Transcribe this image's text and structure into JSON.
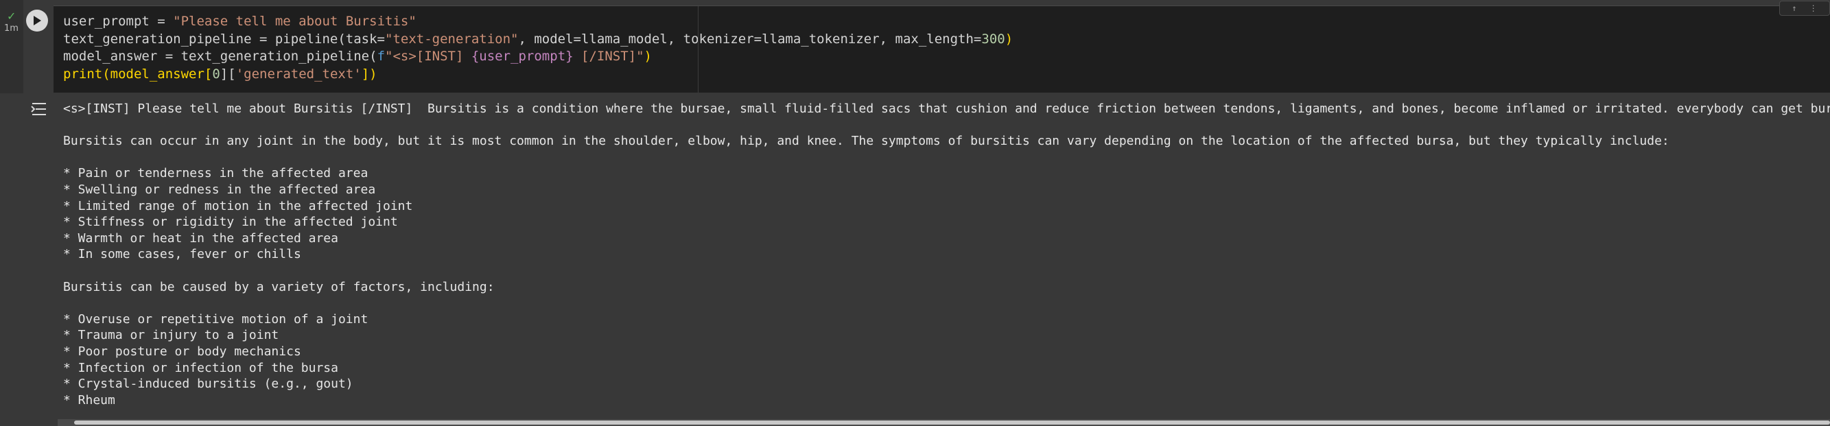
{
  "cell": {
    "status_icon": "check-icon",
    "exec_time": "1m",
    "code_lines": {
      "line1": {
        "a": "user_prompt = ",
        "b": "\"Please tell me about Bursitis\""
      },
      "line2": {
        "a": "text_generation_pipeline = pipeline(task=",
        "b": "\"text-generation\"",
        "c": ", model=llama_model, tokenizer=llama_tokenizer, max_length=",
        "d": "300",
        "e": ")"
      },
      "line3": {
        "a": "model_answer = text_generation_pipeline(",
        "f": "f",
        "b": "\"<s>[INST] ",
        "c": "{user_prompt}",
        "d": " [/INST]\"",
        "e": ")"
      },
      "line4": {
        "a": "print(model_answer[",
        "b": "0",
        "c": "][",
        "d": "'generated_text'",
        "e": "])"
      }
    }
  },
  "output": {
    "icon": "output-options-icon",
    "lines": [
      "<s>[INST] Please tell me about Bursitis [/INST]  Bursitis is a condition where the bursae, small fluid-filled sacs that cushion and reduce friction between tendons, ligaments, and bones, become inflamed or irritated. everybody can get bursitis",
      "",
      "Bursitis can occur in any joint in the body, but it is most common in the shoulder, elbow, hip, and knee. The symptoms of bursitis can vary depending on the location of the affected bursa, but they typically include:",
      "",
      "* Pain or tenderness in the affected area",
      "* Swelling or redness in the affected area",
      "* Limited range of motion in the affected joint",
      "* Stiffness or rigidity in the affected joint",
      "* Warmth or heat in the affected area",
      "* In some cases, fever or chills",
      "",
      "Bursitis can be caused by a variety of factors, including:",
      "",
      "* Overuse or repetitive motion of a joint",
      "* Trauma or injury to a joint",
      "* Poor posture or body mechanics",
      "* Infection or infection of the bursa",
      "* Crystal-induced bursitis (e.g., gout)",
      "* Rheum"
    ]
  },
  "colors": {
    "background": "#383838",
    "code_background": "#1e1e1e",
    "string": "#ce9178",
    "number": "#b5cea8",
    "brace": "#c586c0",
    "success": "#5fb860"
  }
}
